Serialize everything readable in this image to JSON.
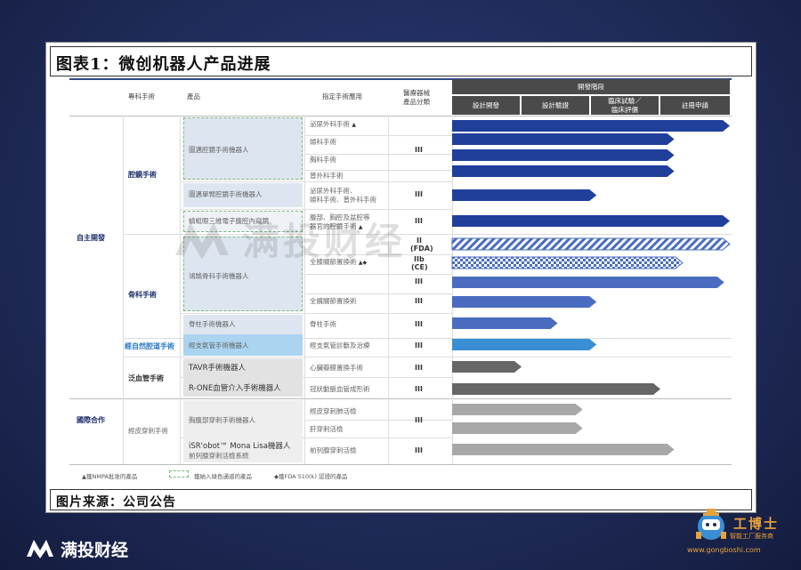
{
  "title": "图表1：微创机器人产品进展",
  "source": "图片来源：公司公告",
  "headers": {
    "specialty": "專科手術",
    "product": "產品",
    "application": "指定手術應用",
    "device_class_1": "醫療器械",
    "device_class_2": "產品分類",
    "stage_group": "開發階段",
    "stages": [
      "設計開發",
      "設計驗證",
      "臨床試驗／",
      "註冊申請"
    ],
    "stage_3_line2": "臨床評價"
  },
  "groups": {
    "self_dev": "自主開發",
    "intl": "國際合作"
  },
  "specialties": {
    "laparoscopic": "腔鏡手術",
    "orthopedic": "骨科手術",
    "natural_orifice": "經自然腔道手術",
    "vascular": "泛血管手術",
    "percutaneous": "經皮穿刺手術"
  },
  "products": {
    "p1": "圖邁腔鏡手術機器人",
    "p2": "圖邁單臂腔鏡手術機器人",
    "p3": "蜻蜓眼三維電子腹腔內窺鏡",
    "p4": "鴻鵠骨科手術機器人",
    "p5": "脊柱手術機器人",
    "p6": "經支氣管手術機器人",
    "p7": "TAVR手術機器人",
    "p8": "R-ONE血管介入手術機器人",
    "p9": "胸腹部穿刺手術機器人",
    "p10_1": "iSR'obot™ Mona Lisa機器人",
    "p10_2": "前列腺穿刺活檢系統"
  },
  "applications": {
    "a1": "泌尿外科手術",
    "a1_mark": "▲",
    "a2": "婦科手術",
    "a3": "胸科手術",
    "a4": "普外科手術",
    "a5_1": "泌尿外科手術、",
    "a5_2": "婦科手術、普外科手術",
    "a6_1": "腹部、胸腔及盆腔等",
    "a6_2": "器官的腔鏡手術",
    "a6_mark": "▲",
    "a7": "全膝關節置換術",
    "a7_mark": "▲◆",
    "a8": "全髖關節置換術",
    "a9": "脊柱手術",
    "a10": "經支氣管診斷及治療",
    "a11": "心臟瓣膜置換手術",
    "a12": "冠狀動脈血管成形術",
    "a13": "經皮穿刺肺活檢",
    "a14": "肝穿刺活檢",
    "a15": "前列腺穿刺活檢"
  },
  "classes": {
    "c3": "III",
    "c_fda_1": "II",
    "c_fda_2": "(FDA)",
    "c_ce_1": "IIb",
    "c_ce_2": "(CE)"
  },
  "progress": [
    {
      "row": "泌尿外科手術",
      "stage_fraction": 1.0,
      "color": "#1f3f9a",
      "pattern": "solid"
    },
    {
      "row": "婦科手術",
      "stage_fraction": 0.8,
      "color": "#1f3f9a",
      "pattern": "solid"
    },
    {
      "row": "胸科手術",
      "stage_fraction": 0.8,
      "color": "#1f3f9a",
      "pattern": "solid"
    },
    {
      "row": "普外科手術",
      "stage_fraction": 0.8,
      "color": "#1f3f9a",
      "pattern": "solid"
    },
    {
      "row": "單臂",
      "stage_fraction": 0.52,
      "color": "#1f3f9a",
      "pattern": "solid"
    },
    {
      "row": "蜻蜓眼",
      "stage_fraction": 1.0,
      "color": "#1f3f9a",
      "pattern": "solid"
    },
    {
      "row": "FDA",
      "stage_fraction": 1.0,
      "color": "#4a6cc0",
      "pattern": "stripe"
    },
    {
      "row": "CE",
      "stage_fraction": 0.83,
      "color": "#4a6cc0",
      "pattern": "check"
    },
    {
      "row": "全膝",
      "stage_fraction": 0.98,
      "color": "#4a6cc0",
      "pattern": "solid"
    },
    {
      "row": "全髖",
      "stage_fraction": 0.52,
      "color": "#4a6cc0",
      "pattern": "solid"
    },
    {
      "row": "脊柱",
      "stage_fraction": 0.38,
      "color": "#4a6cc0",
      "pattern": "solid"
    },
    {
      "row": "經支氣管",
      "stage_fraction": 0.52,
      "color": "#3a8fd4",
      "pattern": "solid"
    },
    {
      "row": "TAVR",
      "stage_fraction": 0.25,
      "color": "#666666",
      "pattern": "solid"
    },
    {
      "row": "R-ONE",
      "stage_fraction": 0.75,
      "color": "#666666",
      "pattern": "solid"
    },
    {
      "row": "肺活檢",
      "stage_fraction": 0.47,
      "color": "#a8a8a8",
      "pattern": "solid"
    },
    {
      "row": "肝活檢",
      "stage_fraction": 0.47,
      "color": "#a8a8a8",
      "pattern": "solid"
    },
    {
      "row": "前列腺",
      "stage_fraction": 0.8,
      "color": "#a8a8a8",
      "pattern": "solid"
    }
  ],
  "legend": {
    "l1": "▲獲NMPA批准的產品",
    "l2": "獲納入綠色通道的產品",
    "l3": "◆獲FDA 510(k) 認證的產品"
  },
  "watermark": "满投财经",
  "footer_brand": "满投财经",
  "gbs": {
    "name": "工博士",
    "sub": "智能工厂服务商",
    "url": "www.gongboshi.com"
  }
}
